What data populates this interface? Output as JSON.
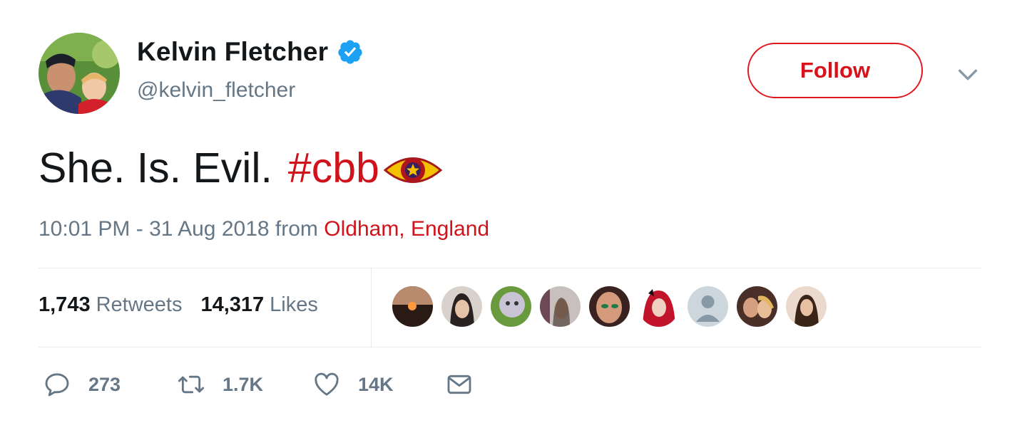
{
  "user": {
    "display_name": "Kelvin Fletcher",
    "handle": "@kelvin_fletcher",
    "verified": true
  },
  "follow_button": {
    "label": "Follow"
  },
  "tweet": {
    "text": "She. Is. Evil.",
    "hashtag": "#cbb",
    "emoji": "cbb-eye-icon"
  },
  "meta": {
    "timestamp": "10:01 PM - 31 Aug 2018",
    "from_label": "from",
    "location": "Oldham, England"
  },
  "stats": {
    "retweets_count": "1,743",
    "retweets_label": "Retweets",
    "likes_count": "14,317",
    "likes_label": "Likes"
  },
  "liker_avatars": 9,
  "actions": {
    "replies": "273",
    "retweets": "1.7K",
    "likes": "14K"
  },
  "colors": {
    "accent_red": "#d0121a",
    "secondary_text": "#657786",
    "verified_blue": "#1da1f2"
  }
}
